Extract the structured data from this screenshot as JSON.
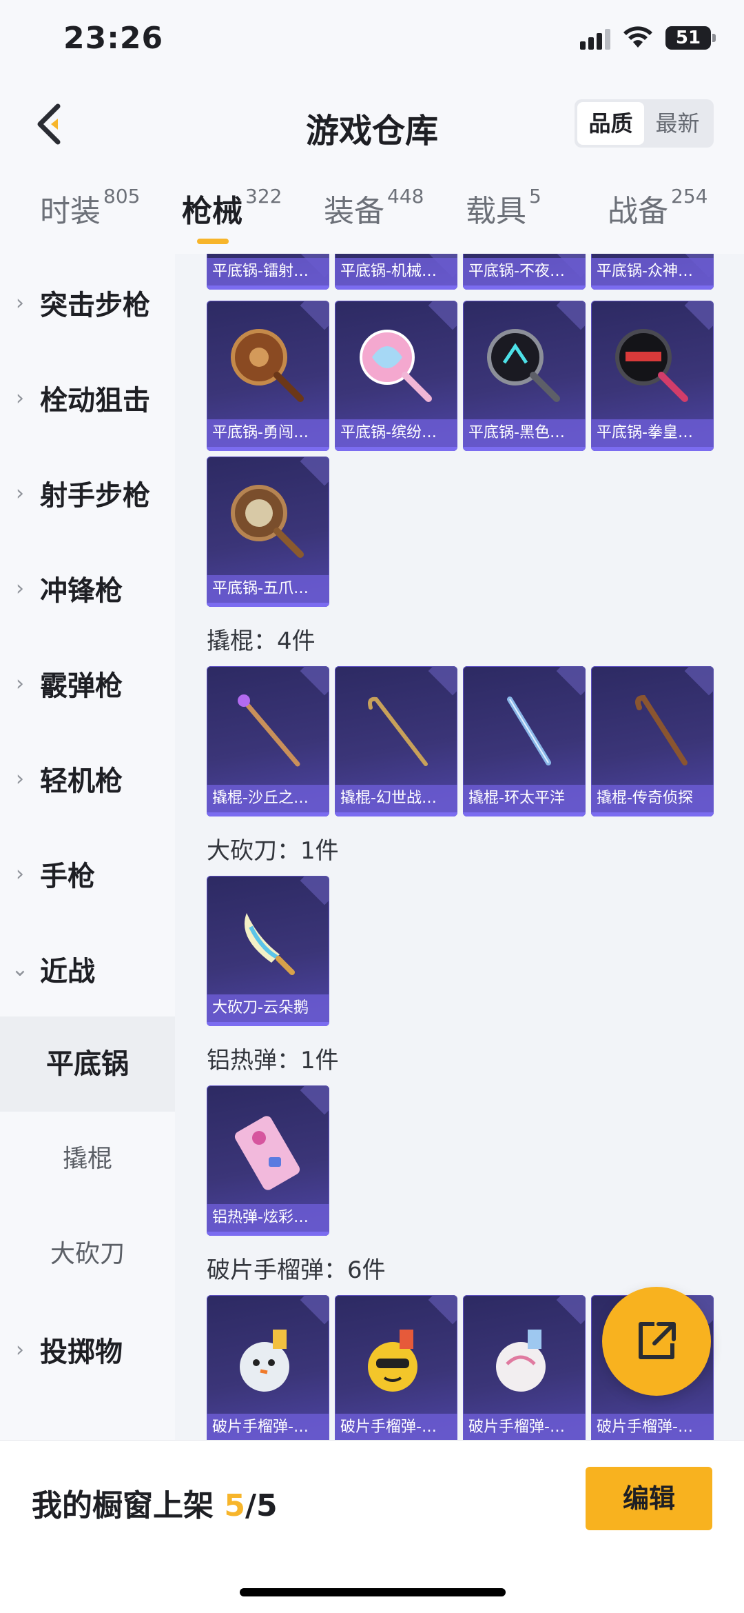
{
  "status_bar": {
    "time": "23:26",
    "battery": "51"
  },
  "header": {
    "title": "游戏仓库",
    "sort_options": [
      "品质",
      "最新"
    ],
    "sort_active": "品质"
  },
  "tabs": [
    {
      "label": "时装",
      "count": "805"
    },
    {
      "label": "枪械",
      "count": "322",
      "active": true
    },
    {
      "label": "装备",
      "count": "448"
    },
    {
      "label": "载具",
      "count": "5"
    },
    {
      "label": "战备",
      "count": "254"
    }
  ],
  "sidebar": {
    "categories": [
      "突击步枪",
      "栓动狙击",
      "射手步枪",
      "冲锋枪",
      "霰弹枪",
      "轻机枪",
      "手枪",
      "近战",
      "投掷物"
    ],
    "subcategories": [
      "平底锅",
      "撬棍",
      "大砍刀"
    ],
    "active_sub": "平底锅"
  },
  "content": {
    "pan_row_partial": [
      "平底锅-镭射…",
      "平底锅-机械…",
      "平底锅-不夜…",
      "平底锅-众神…"
    ],
    "pan_row": [
      "平底锅-勇闯…",
      "平底锅-缤纷…",
      "平底锅-黑色…",
      "平底锅-拳皇…"
    ],
    "pan_last": [
      "平底锅-五爪…"
    ],
    "crowbar_section": {
      "title": "撬棍：4件",
      "items": [
        "撬棍-沙丘之…",
        "撬棍-幻世战…",
        "撬棍-环太平洋",
        "撬棍-传奇侦探"
      ]
    },
    "machete_section": {
      "title": "大砍刀：1件",
      "items": [
        "大砍刀-云朵鹅"
      ]
    },
    "thermite_section": {
      "title": "铝热弹：1件",
      "items": [
        "铝热弹-炫彩…"
      ]
    },
    "grenade_section": {
      "title": "破片手榴弹：6件",
      "items": [
        "破片手榴弹-…",
        "破片手榴弹-…",
        "破片手榴弹-…",
        "破片手榴弹-…"
      ]
    }
  },
  "bottom_bar": {
    "showcase_label": "我的橱窗上架",
    "showcase_count": "5",
    "showcase_total": "/5",
    "edit_label": "编辑"
  },
  "colors": {
    "accent": "#f8b21f",
    "card_bg": "#3b3578",
    "card_label": "#6b5cd2"
  }
}
